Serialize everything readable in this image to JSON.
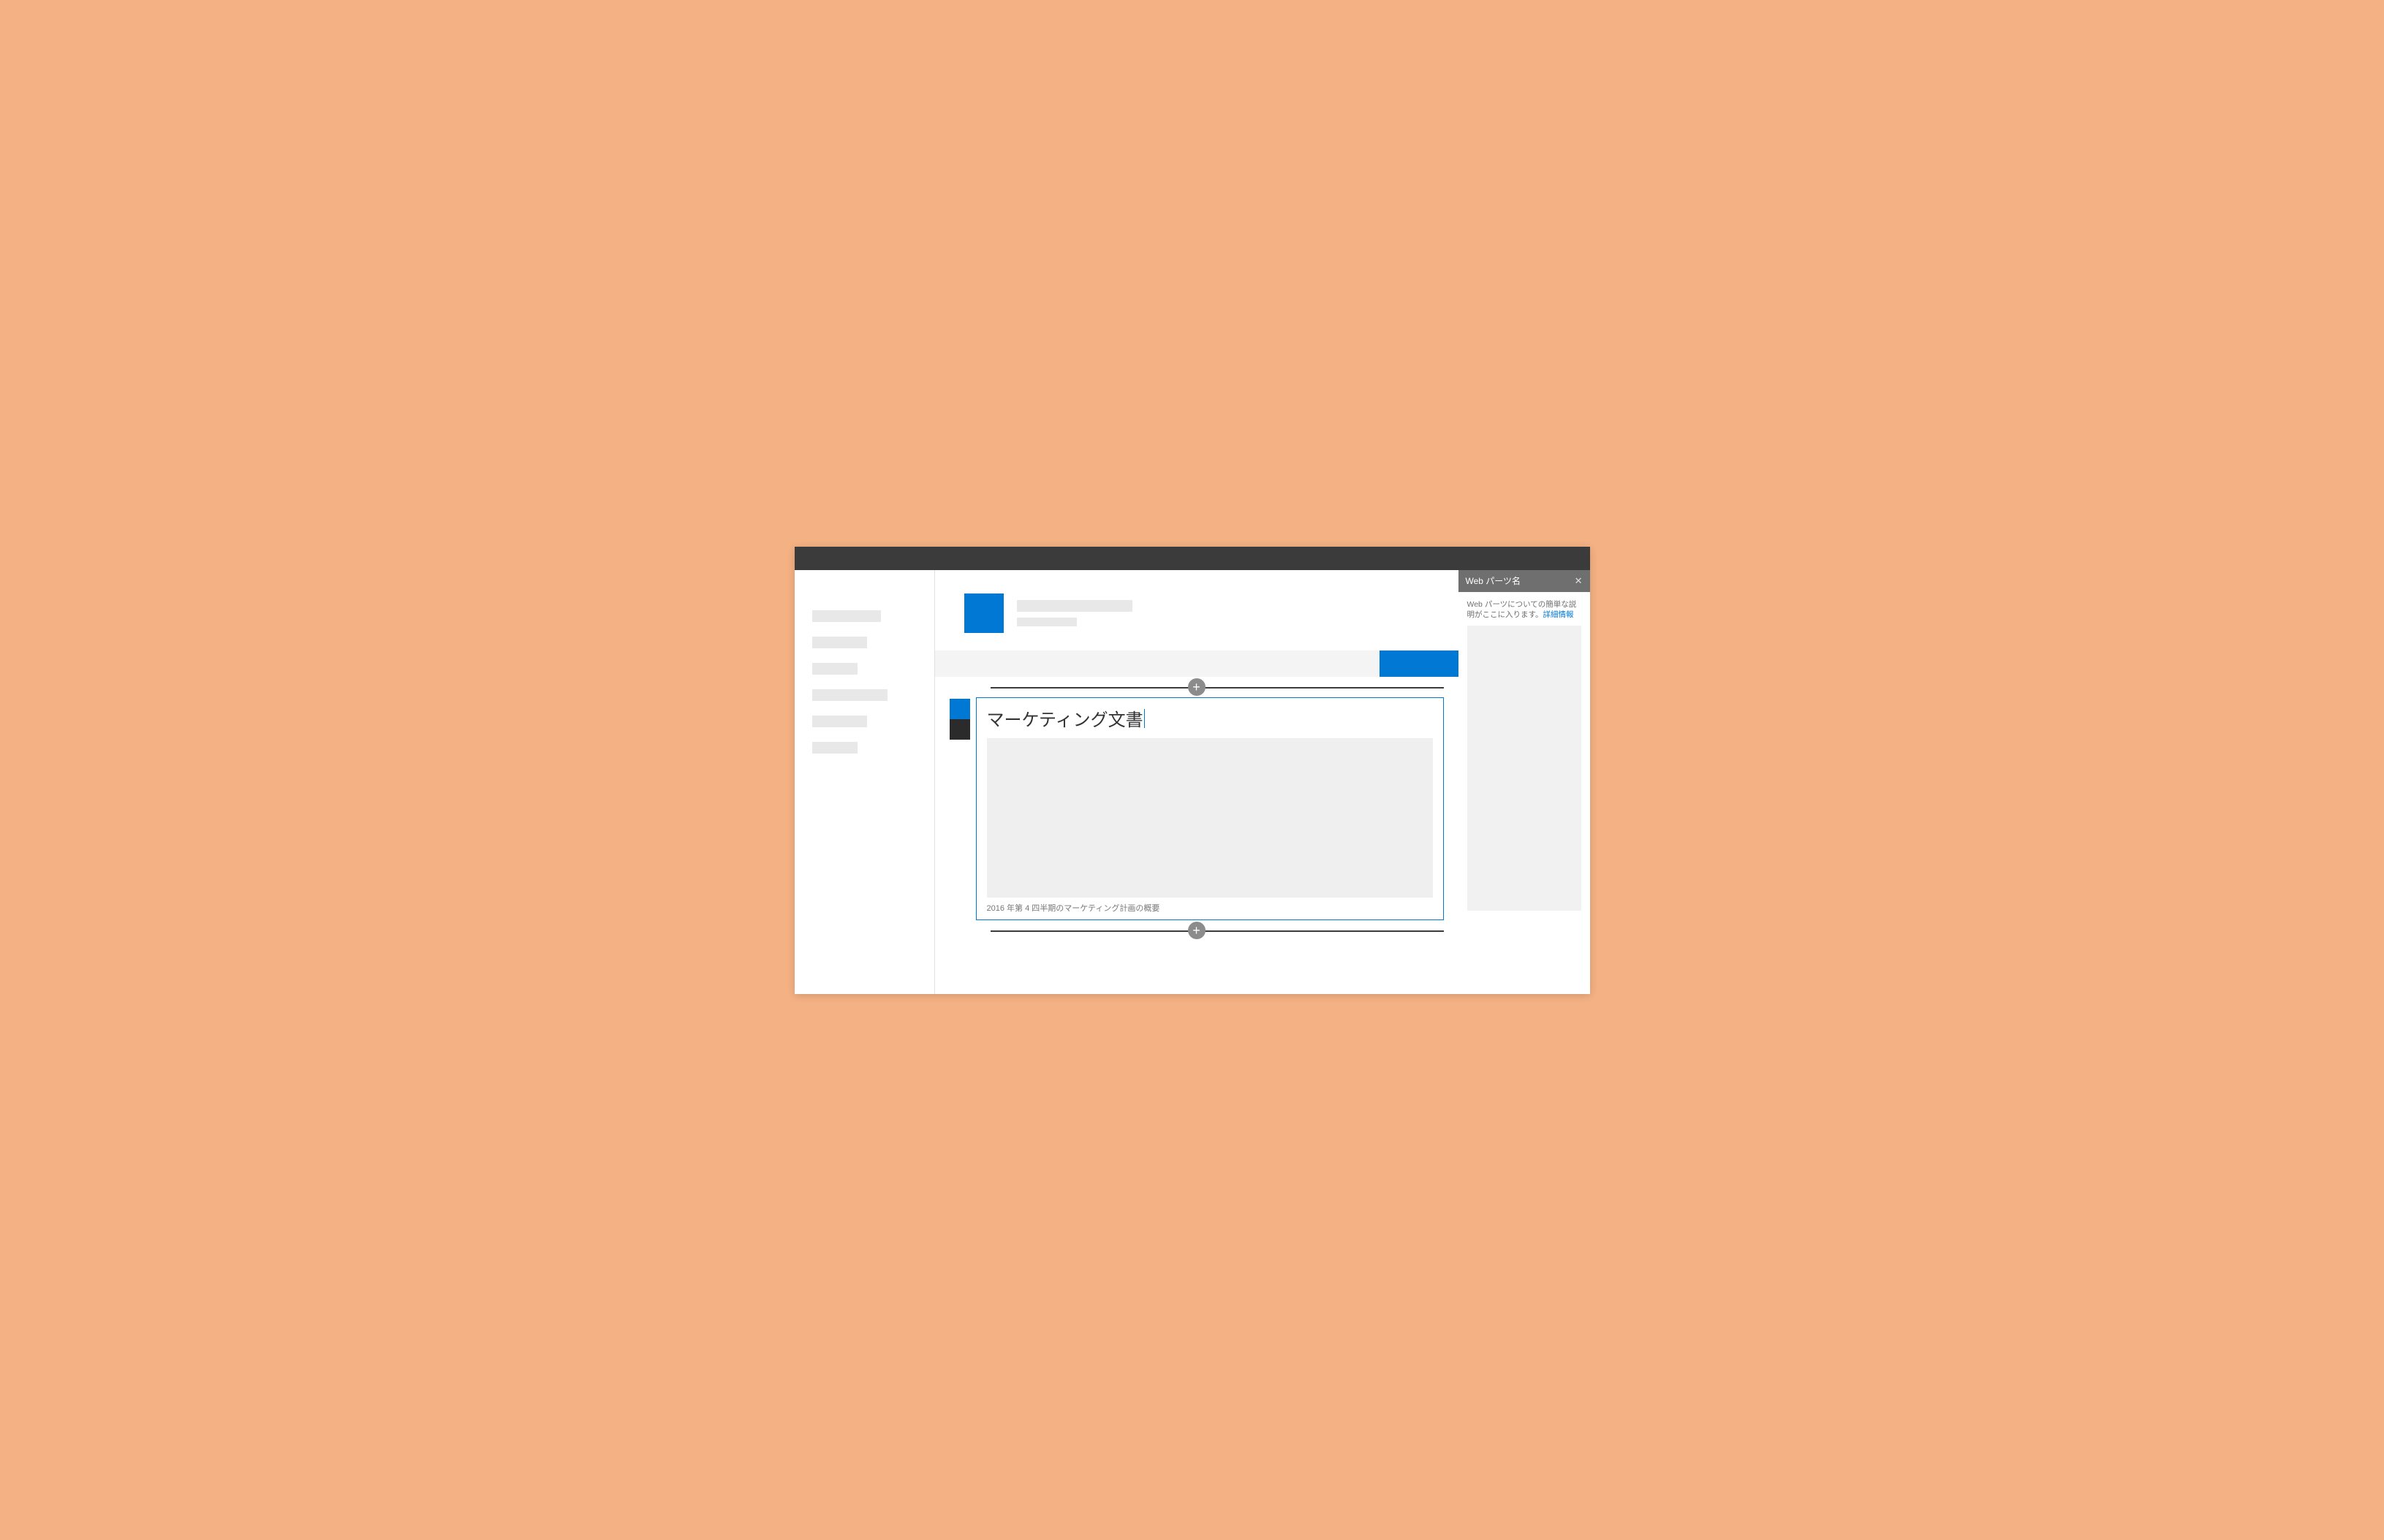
{
  "colors": {
    "accent": "#0078d4",
    "background": "#f4b183"
  },
  "webpart": {
    "title": "マーケティング文書",
    "caption": "2016 年第 4 四半期のマーケティング計画の概要"
  },
  "pane": {
    "title": "Web パーツ名",
    "description_prefix": "Web パーツについての簡単な説明がここに入ります。",
    "more_link": "詳細情報",
    "close_glyph": "✕"
  },
  "add_glyph": "+"
}
